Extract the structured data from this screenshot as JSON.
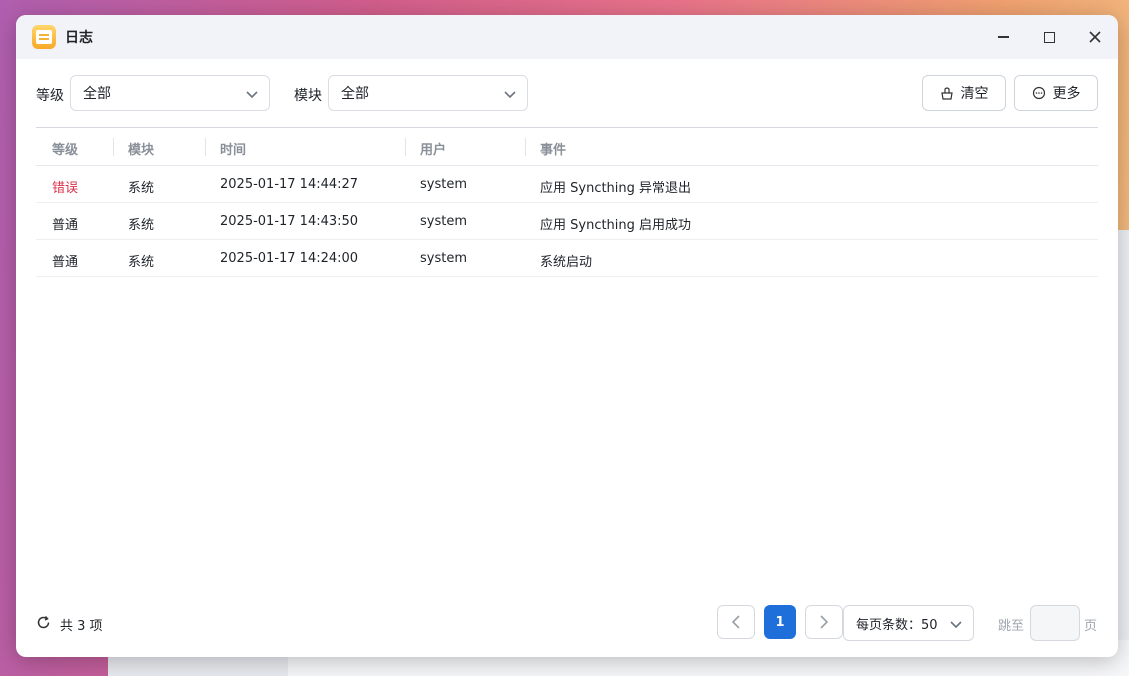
{
  "window": {
    "title": "日志",
    "icon": "log-app-icon"
  },
  "filters": {
    "level_label": "等级",
    "level_value": "全部",
    "module_label": "模块",
    "module_value": "全部"
  },
  "actions": {
    "clear_label": "清空",
    "more_label": "更多"
  },
  "table": {
    "headers": {
      "level": "等级",
      "module": "模块",
      "time": "时间",
      "user": "用户",
      "event": "事件"
    },
    "rows": [
      {
        "level": "错误",
        "module": "系统",
        "time": "2025-01-17 14:44:27",
        "user": "system",
        "event": "应用 Syncthing 异常退出"
      },
      {
        "level": "普通",
        "module": "系统",
        "time": "2025-01-17 14:43:50",
        "user": "system",
        "event": "应用 Syncthing 启用成功"
      },
      {
        "level": "普通",
        "module": "系统",
        "time": "2025-01-17 14:24:00",
        "user": "system",
        "event": "系统启动"
      }
    ]
  },
  "footer": {
    "total": "共 3 项",
    "current_page": "1",
    "per_page": "每页条数：50",
    "jump_prefix": "跳至",
    "jump_suffix": "页",
    "jump_value": ""
  },
  "colors": {
    "accent": "#1e6fd9",
    "error": "#d9304a"
  }
}
